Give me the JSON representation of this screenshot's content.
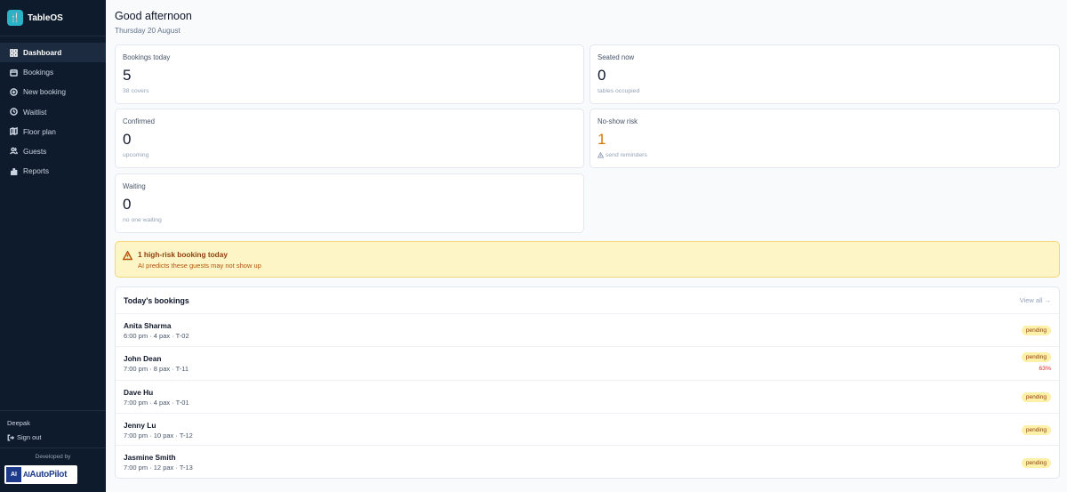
{
  "app": {
    "logo_glyph": "🍴",
    "name": "TableOS"
  },
  "sidebar": {
    "items": [
      {
        "label": "Dashboard",
        "icon": "grid-icon",
        "active": true
      },
      {
        "label": "Bookings",
        "icon": "calendar-icon"
      },
      {
        "label": "New booking",
        "icon": "plus-circle-icon"
      },
      {
        "label": "Waitlist",
        "icon": "clock-icon"
      },
      {
        "label": "Floor plan",
        "icon": "map-icon"
      },
      {
        "label": "Guests",
        "icon": "users-icon"
      },
      {
        "label": "Reports",
        "icon": "bar-chart-icon"
      }
    ],
    "user": "Deepak",
    "signout_label": "Sign out",
    "developed_by_label": "Developed by",
    "dev_logo_mark": "AI",
    "dev_logo_text_ai": "AI",
    "dev_logo_text_main": "AutoPilot"
  },
  "header": {
    "greeting": "Good afternoon",
    "date": "Thursday 20 August"
  },
  "stats": {
    "bookings_today": {
      "label": "Bookings today",
      "value": "5",
      "sub": "38 covers"
    },
    "seated_now": {
      "label": "Seated now",
      "value": "0",
      "sub": "tables occupied"
    },
    "confirmed": {
      "label": "Confirmed",
      "value": "0",
      "sub": "upcoming"
    },
    "no_show": {
      "label": "No-show risk",
      "value": "1",
      "sub": "send reminders"
    },
    "waiting": {
      "label": "Waiting",
      "value": "0",
      "sub": "no one waiting"
    }
  },
  "alert": {
    "title": "1 high-risk booking today",
    "subtitle": "AI predicts these guests may not show up"
  },
  "bookings": {
    "title": "Today's bookings",
    "view_all": "View all →",
    "rows": [
      {
        "name": "Anita Sharma",
        "detail": "6:00 pm · 4 pax · T-02",
        "status": "pending"
      },
      {
        "name": "John Dean",
        "detail": "7:00 pm · 8 pax · T-11",
        "status": "pending",
        "risk": "63%"
      },
      {
        "name": "Dave Hu",
        "detail": "7:00 pm · 4 pax · T-01",
        "status": "pending"
      },
      {
        "name": "Jenny Lu",
        "detail": "7:00 pm · 10 pax · T-12",
        "status": "pending"
      },
      {
        "name": "Jasmine Smith",
        "detail": "7:00 pm · 12 pax · T-13",
        "status": "pending"
      }
    ]
  },
  "colors": {
    "sidebar_bg": "#0e1b2c",
    "brand_accent": "#2ab3c7",
    "warning": "#d97706",
    "alert_bg": "#fdf5c5",
    "badge_bg": "#fdf0a8",
    "risk_red": "#dc2626"
  }
}
